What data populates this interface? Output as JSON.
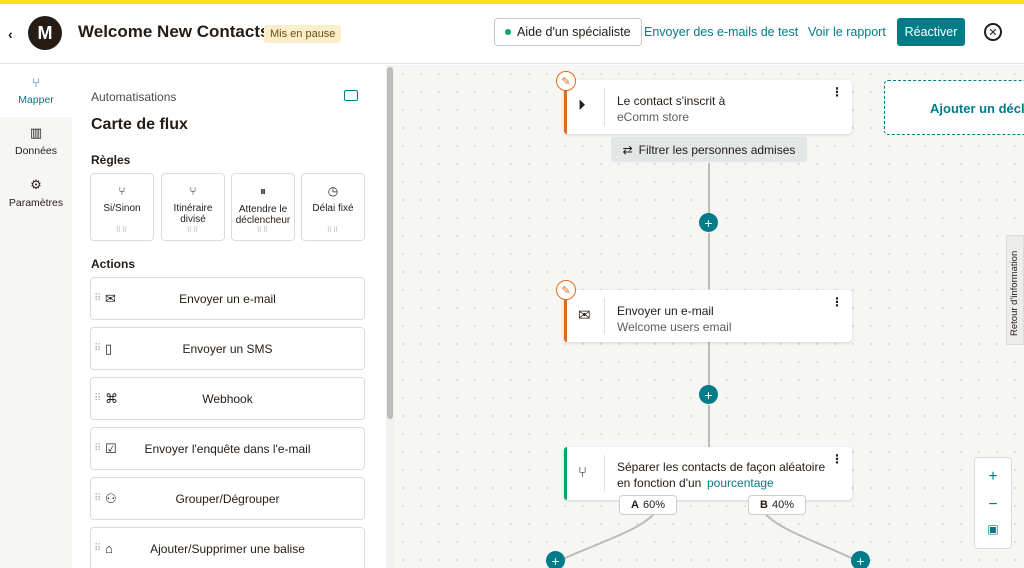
{
  "header": {
    "back": "‹",
    "logo": "M",
    "title": "Welcome New Contacts",
    "status": "Mis en pause",
    "help_label": "Aide d'un spécialiste",
    "send_test_label": "Envoyer des e-mails de test",
    "view_report_label": "Voir le rapport",
    "reactivate_label": "Réactiver",
    "close": "✕"
  },
  "nav": {
    "items": [
      {
        "label": "Mapper",
        "icon": "branch-icon",
        "glyph": "⑂",
        "active": true
      },
      {
        "label": "Données",
        "icon": "bar-chart-icon",
        "glyph": "▥"
      },
      {
        "label": "Paramètres",
        "icon": "gear-icon",
        "glyph": "⚙"
      }
    ]
  },
  "panel": {
    "crumb": "Automatisations",
    "title": "Carte de flux",
    "rules_heading": "Règles",
    "rules": [
      {
        "label": "Si/Sinon",
        "glyph": "⑂"
      },
      {
        "label": "Itinéraire divisé",
        "glyph": "⑂"
      },
      {
        "label": "Attendre le déclencheur",
        "glyph": "⏸"
      },
      {
        "label": "Délai fixé",
        "glyph": "◷"
      }
    ],
    "actions_heading": "Actions",
    "actions": [
      {
        "label": "Envoyer un e-mail",
        "glyph": "✉"
      },
      {
        "label": "Envoyer un SMS",
        "glyph": "▯"
      },
      {
        "label": "Webhook",
        "glyph": "⌘"
      },
      {
        "label": "Envoyer l'enquête dans l'e-mail",
        "glyph": "☑"
      },
      {
        "label": "Grouper/Dégrouper",
        "glyph": "⚇"
      },
      {
        "label": "Ajouter/Supprimer une balise",
        "glyph": "⌂"
      }
    ]
  },
  "canvas": {
    "trigger": {
      "title": "Le contact s'inscrit à",
      "subtitle": "eComm store"
    },
    "filter_label": "Filtrer les personnes admises",
    "add_trigger_label": "Ajouter un décle",
    "email": {
      "title": "Envoyer un e-mail",
      "subtitle": "Welcome users email"
    },
    "split": {
      "title": "Séparer les contacts de façon aléatoire",
      "subtitle_prefix": "en fonction d'un",
      "subtitle_link": "pourcentage"
    },
    "branch_a": {
      "letter": "A",
      "percent": "60%"
    },
    "branch_b": {
      "letter": "B",
      "percent": "40%"
    },
    "zoom_in": "+",
    "zoom_out": "−",
    "feedback": "Retour d'information"
  },
  "colors": {
    "accent": "#007c89",
    "brand": "#ffe01b",
    "edit": "#e06c1b",
    "split_bar": "#00a862"
  }
}
